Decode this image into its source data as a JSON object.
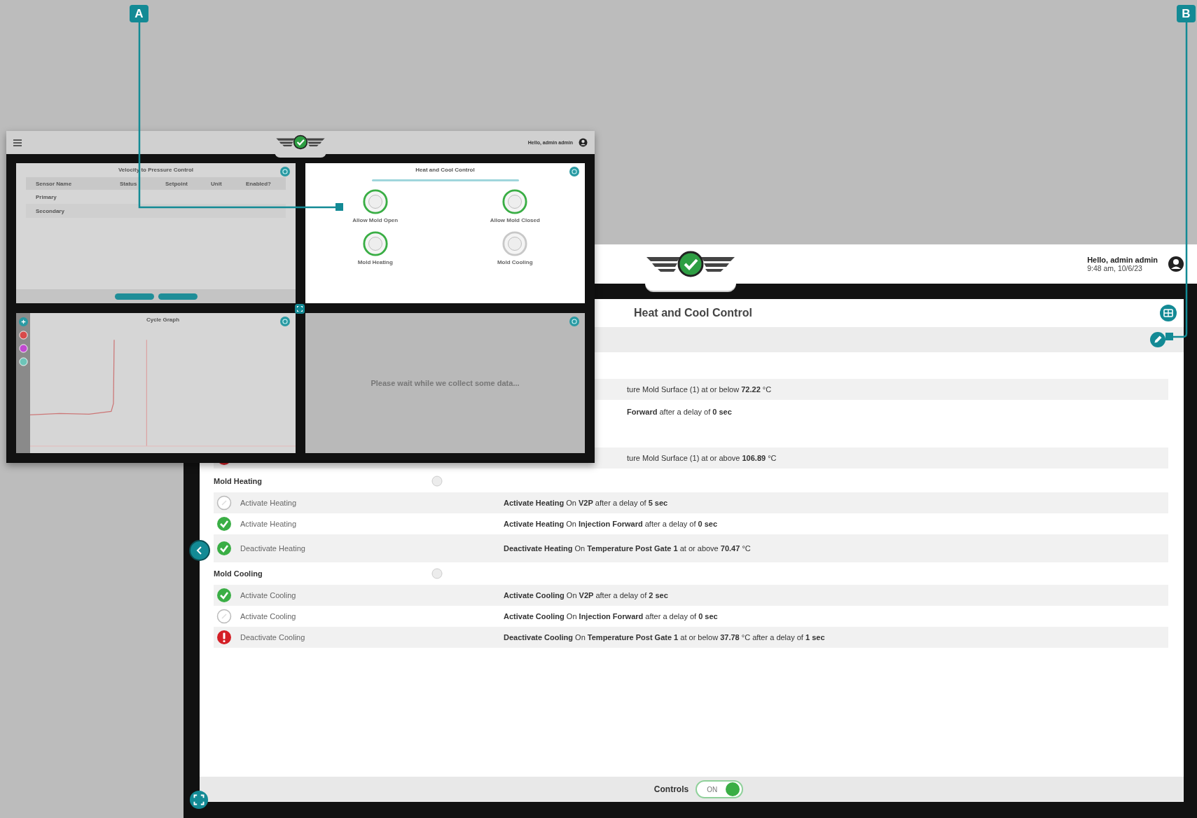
{
  "callouts": [
    {
      "letter": "A"
    },
    {
      "letter": "B"
    }
  ],
  "back_screen": {
    "user": {
      "greeting": "Hello, admin admin",
      "time": "9:48 am, 10/6/23"
    },
    "panel_title": "Heat and Cool Control",
    "rows": [
      {
        "kind": "partial",
        "detail": "ture Mold Surface (1) at or below **72.22** °C"
      },
      {
        "kind": "partial",
        "detail": "**Forward** after a delay of **0 sec**"
      },
      {
        "kind": "partial",
        "alert": true,
        "detail": "ture Mold Surface (1) at or above **106.89** °C"
      },
      {
        "kind": "section",
        "label": "Mold Heating"
      },
      {
        "kind": "rule",
        "done": false,
        "alert": false,
        "label": "Activate Heating",
        "detail": "**Activate Heating** On **V2P** after a delay of **5 sec**"
      },
      {
        "kind": "rule",
        "done": true,
        "alert": false,
        "label": "Activate Heating",
        "detail": "**Activate Heating** On **Injection Forward** after a delay of **0 sec**"
      },
      {
        "kind": "rule",
        "done": true,
        "alert": false,
        "label": "Deactivate Heating",
        "detail": "**Deactivate Heating** On **Temperature Post Gate 1** at or above **70.47** °C"
      },
      {
        "kind": "section",
        "label": "Mold Cooling"
      },
      {
        "kind": "rule",
        "done": true,
        "alert": false,
        "label": "Activate Cooling",
        "detail": "**Activate Cooling** On **V2P** after a delay of **2 sec**"
      },
      {
        "kind": "rule",
        "done": false,
        "alert": false,
        "label": "Activate Cooling",
        "detail": "**Activate Cooling** On **Injection Forward** after a delay of **0 sec**"
      },
      {
        "kind": "rule",
        "alert": true,
        "label": "Deactivate Cooling",
        "detail": "**Deactivate Cooling** On **Temperature Post Gate 1** at or below **37.78** °C after a delay of **1 sec**"
      }
    ],
    "controls": {
      "label": "Controls",
      "toggle_text": "ON",
      "on": true
    }
  },
  "front_screen": {
    "user": {
      "greeting": "Hello, admin admin"
    },
    "v2p": {
      "title": "Velocity to Pressure Control",
      "columns": [
        "Sensor Name",
        "Status",
        "Setpoint",
        "Unit",
        "Enabled?"
      ],
      "rows": [
        "Primary",
        "Secondary"
      ]
    },
    "heat_cool": {
      "title": "Heat and Cool Control",
      "indicators": [
        {
          "label": "Allow Mold Open",
          "active": true
        },
        {
          "label": "Allow Mold Closed",
          "active": true
        },
        {
          "label": "Mold Heating",
          "active": true
        },
        {
          "label": "Mold Cooling",
          "active": false
        }
      ]
    },
    "cycle_graph": {
      "title": "Cycle Graph"
    },
    "waiting": {
      "message": "Please wait while we collect some data..."
    }
  }
}
